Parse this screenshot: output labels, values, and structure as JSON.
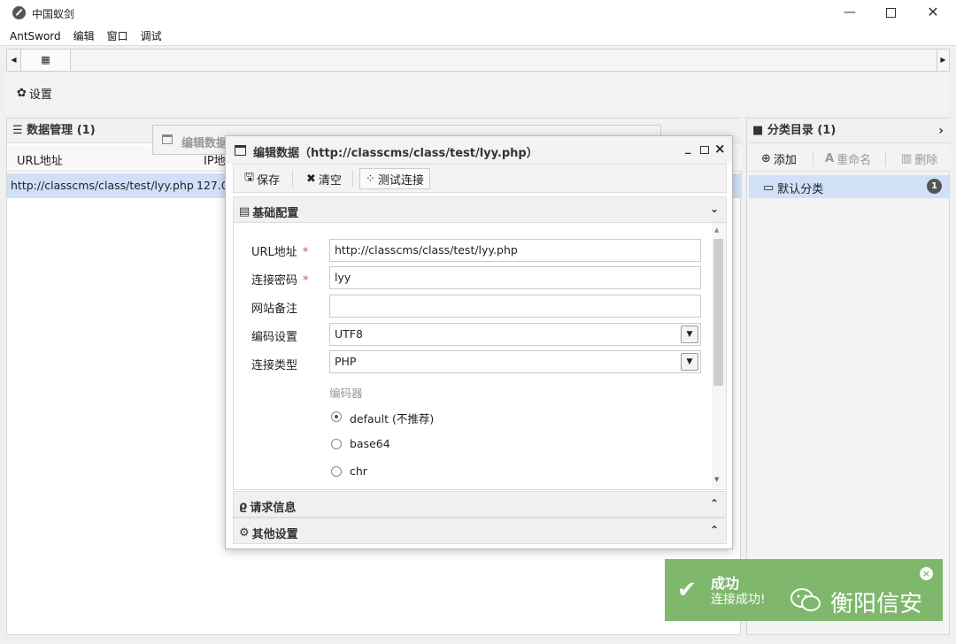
{
  "window": {
    "title": "中国蚁剑",
    "min": "—",
    "close": "✕"
  },
  "menu": [
    "AntSword",
    "编辑",
    "窗口",
    "调试"
  ],
  "tabs": {
    "home": "▦"
  },
  "toolbar": {
    "settings_label": "设置"
  },
  "data_panel": {
    "title": "☰ 数据管理 (1)",
    "columns": {
      "url": "URL地址",
      "ip": "IP地"
    },
    "rows": [
      {
        "url": "http://classcms/class/test/lyy.php",
        "ip": "127.0"
      }
    ]
  },
  "ghost_window": {
    "title": "编辑数据"
  },
  "category_panel": {
    "title": "分类目录 (1)",
    "add": "添加",
    "rename": "重命名",
    "delete": "删除",
    "items": [
      {
        "label": "默认分类",
        "count": "1"
      }
    ]
  },
  "dialog": {
    "title": "编辑数据（http://classcms/class/test/lyy.php）",
    "buttons": {
      "save": "保存",
      "clear": "清空",
      "test": "测试连接"
    },
    "sections": {
      "basic": "基础配置",
      "request": "请求信息",
      "other": "其他设置"
    },
    "form": {
      "url_label": "URL地址",
      "url_value": "http://classcms/class/test/lyy.php",
      "password_label": "连接密码",
      "password_value": "lyy",
      "note_label": "网站备注",
      "note_value": "",
      "encoding_label": "编码设置",
      "encoding_value": "UTF8",
      "type_label": "连接类型",
      "type_value": "PHP",
      "encoder_label": "编码器",
      "encoders": [
        {
          "label": "default (不推荐)",
          "checked": true
        },
        {
          "label": "base64",
          "checked": false
        },
        {
          "label": "chr",
          "checked": false
        }
      ]
    }
  },
  "toast": {
    "title": "成功",
    "message": "连接成功!"
  },
  "watermark": {
    "text": "衡阳信安"
  },
  "colors": {
    "selection": "#cfe0f7",
    "toast": "#7fb76c",
    "required": "#d9534f"
  }
}
